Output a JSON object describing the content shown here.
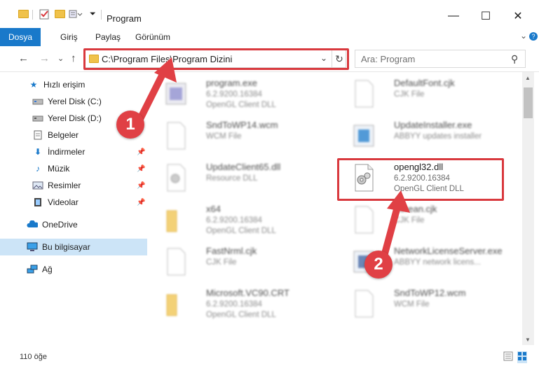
{
  "window": {
    "title": "Program",
    "minimize": "—",
    "maximize": "☐",
    "close": "✕"
  },
  "ribbon": {
    "tabs": [
      "Dosya",
      "Giriş",
      "Paylaş",
      "Görünüm"
    ],
    "expand": "⌄",
    "help": "?"
  },
  "nav": {
    "back": "←",
    "forward": "→",
    "recent": "⌄",
    "up": "↑"
  },
  "address": {
    "path": "C:\\Program Files\\Program Dizini",
    "dropdown": "⌄",
    "refresh": "↻"
  },
  "search": {
    "placeholder": "Ara: Program",
    "icon": "⚲"
  },
  "sidebar": {
    "items": [
      {
        "label": "Hızlı erişim",
        "icon": "star-icon"
      },
      {
        "label": "Yerel Disk (C:)",
        "icon": "drive-icon"
      },
      {
        "label": "Yerel Disk (D:)",
        "icon": "drive-icon"
      },
      {
        "label": "Belgeler",
        "icon": "documents-icon"
      },
      {
        "label": "İndirmeler",
        "icon": "download-icon"
      },
      {
        "label": "Müzik",
        "icon": "music-icon"
      },
      {
        "label": "Resimler",
        "icon": "pictures-icon"
      },
      {
        "label": "Videolar",
        "icon": "videos-icon"
      },
      {
        "label": "OneDrive",
        "icon": "cloud-icon"
      },
      {
        "label": "Bu bilgisayar",
        "icon": "computer-icon"
      },
      {
        "label": "Ağ",
        "icon": "network-icon"
      }
    ]
  },
  "files": [
    {
      "name": "program.exe",
      "line2": "6.2.9200.16384",
      "line3": "OpenGL Client DLL",
      "icon": "exe-icon"
    },
    {
      "name": "DefaultFont.cjk",
      "line2": "CJK File",
      "line3": "",
      "icon": "file-icon"
    },
    {
      "name": "SndToWP14.wcm",
      "line2": "WCM File",
      "line3": "",
      "icon": "file-icon"
    },
    {
      "name": "UpdateInstaller.exe",
      "line2": "ABBYY updates installer",
      "line3": "",
      "icon": "exe-icon"
    },
    {
      "name": "UpdateClient65.dll",
      "line2": "Resource DLL",
      "line3": "",
      "icon": "dll-icon"
    },
    {
      "name": "opengl32.dll",
      "line2": "6.2.9200.16384",
      "line3": "OpenGL Client DLL",
      "icon": "dll-icon"
    },
    {
      "name": "x64",
      "line2": "6.2.9200.16384",
      "line3": "OpenGL Client DLL",
      "icon": "folder-icon"
    },
    {
      "name": "Korean.cjk",
      "line2": "CJK File",
      "line3": "",
      "icon": "file-icon"
    },
    {
      "name": "FastNrml.cjk",
      "line2": "CJK File",
      "line3": "",
      "icon": "file-icon"
    },
    {
      "name": "NetworkLicenseServer.exe",
      "line2": "ABBYY network licens...",
      "line3": "",
      "icon": "exe-icon"
    },
    {
      "name": "Microsoft.VC90.CRT",
      "line2": "6.2.9200.16384",
      "line3": "OpenGL Client DLL",
      "icon": "folder-icon"
    },
    {
      "name": "SndToWP12.wcm",
      "line2": "WCM File",
      "line3": "",
      "icon": "file-icon"
    }
  ],
  "status": {
    "count": "110 öğe"
  },
  "badges": {
    "one": "1",
    "two": "2"
  },
  "colors": {
    "accent": "#1979ca",
    "highlight": "#d9393e",
    "selected": "#cce4f7"
  }
}
